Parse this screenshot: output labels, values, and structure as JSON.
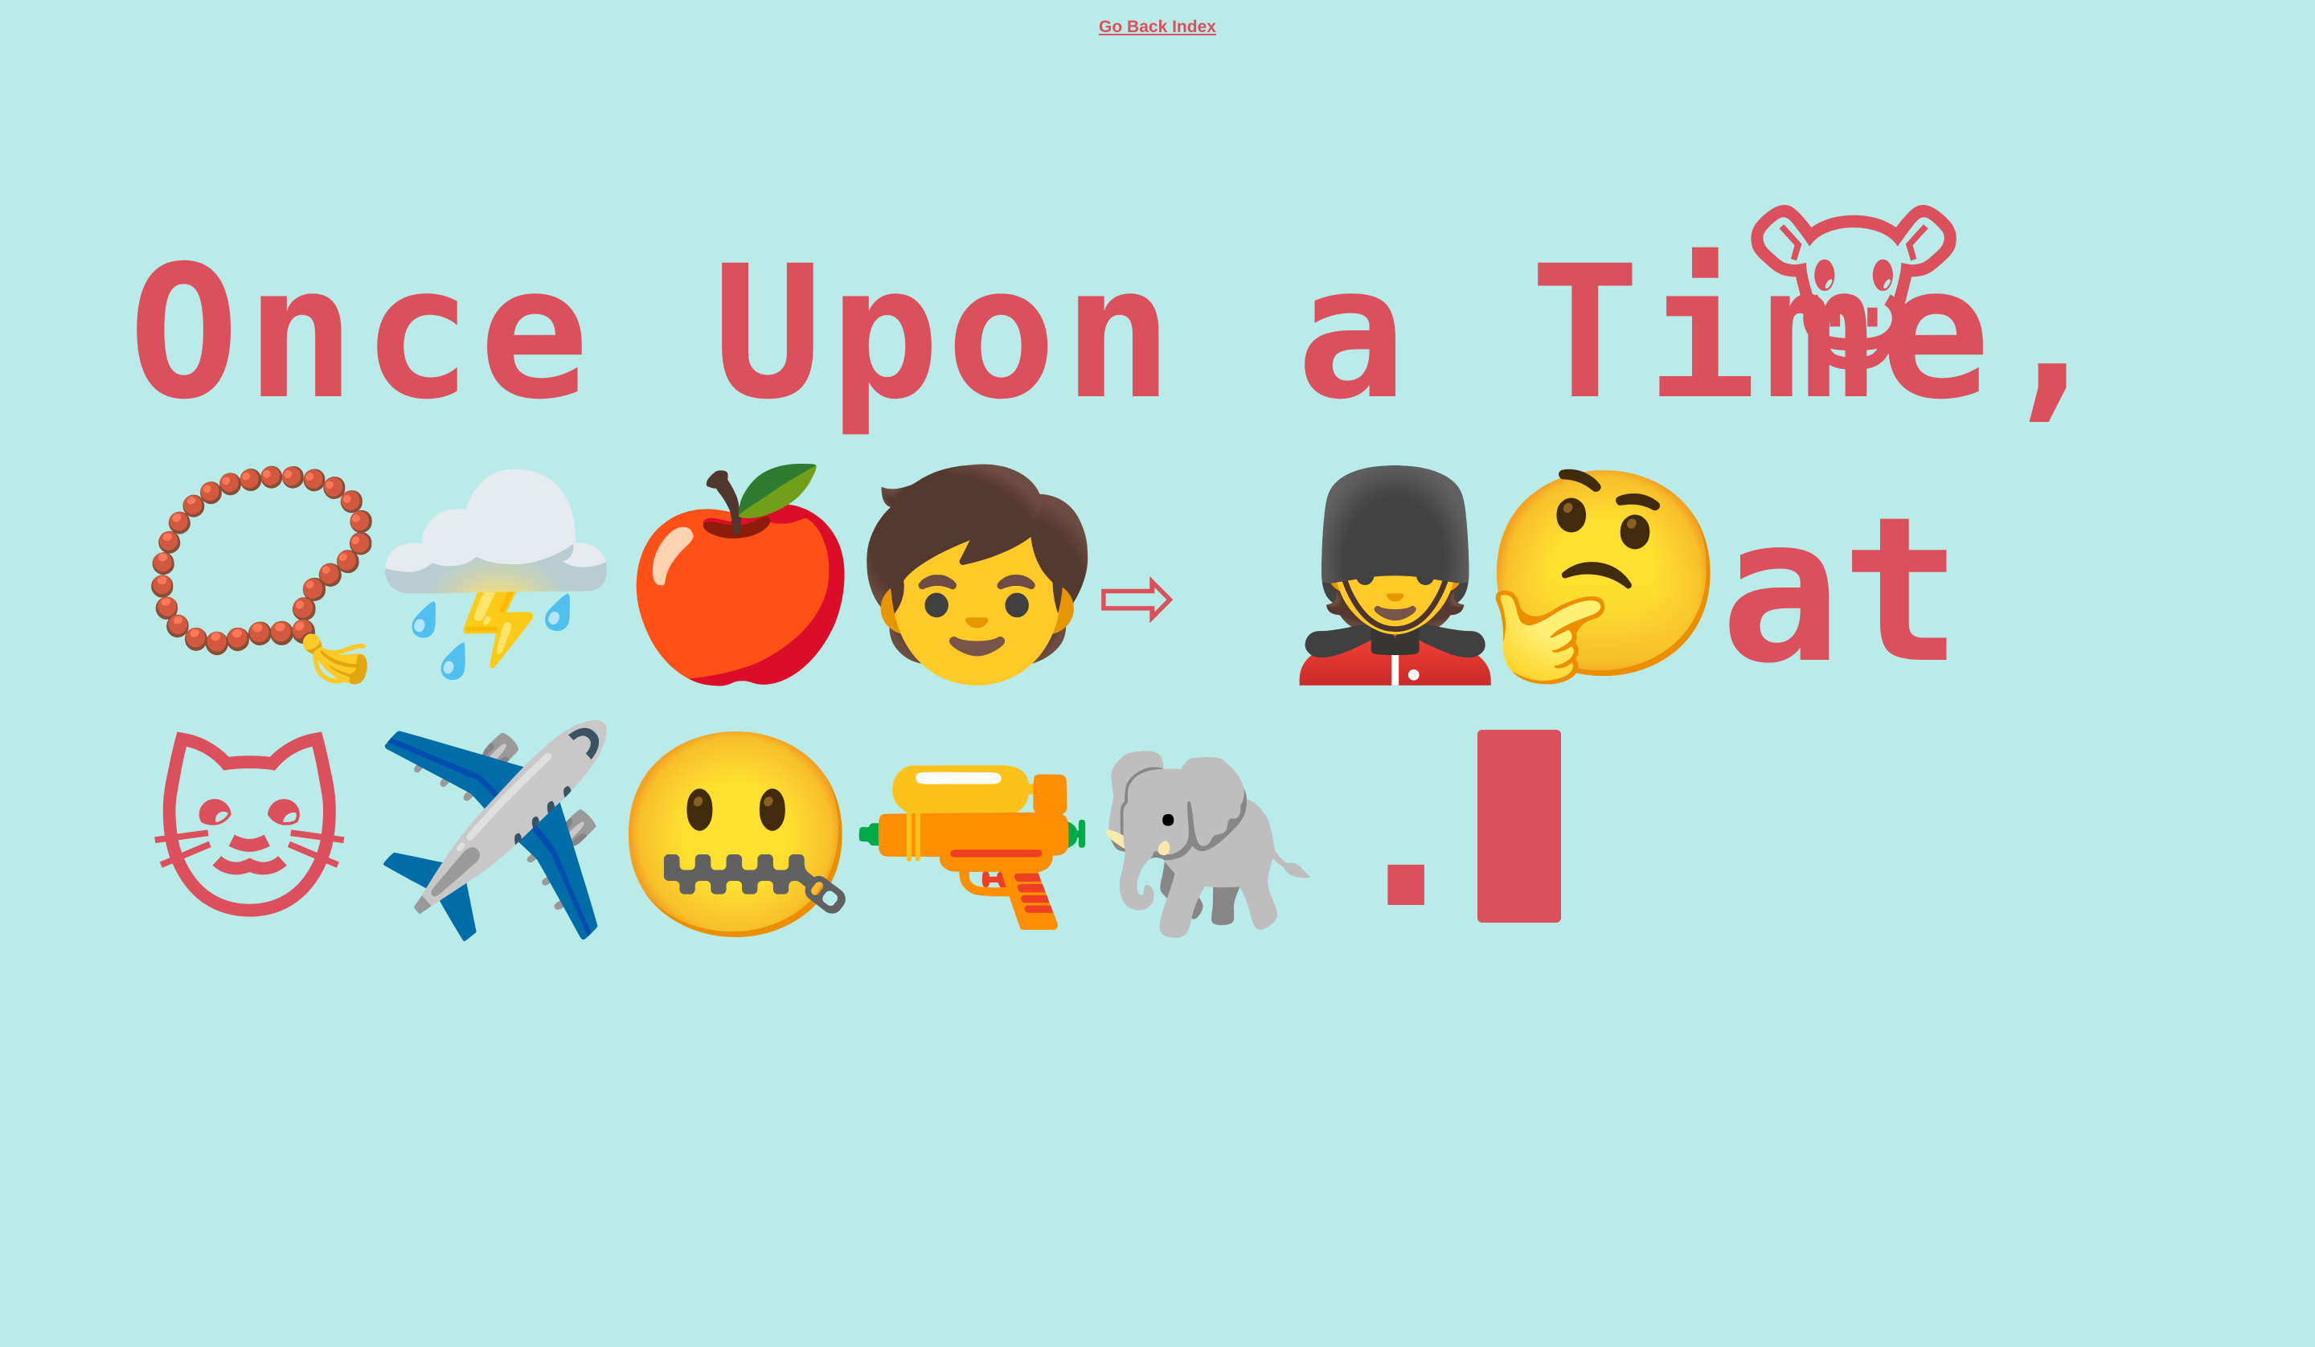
{
  "nav": {
    "back_label": "Go Back Index"
  },
  "story": {
    "line1": {
      "text": "Once Upon a Time,",
      "emoji_cow": "🐮"
    },
    "line2": {
      "emoji_beads": "📿",
      "emoji_storm": "⛈️",
      "emoji_apple": "🍎",
      "emoji_child": "🧒",
      "arrow": "⇨",
      "emoji_guard": "💂",
      "emoji_thinking": "🤔",
      "text_at": "at"
    },
    "line3": {
      "emoji_cat": "🐱",
      "emoji_plane": "✈️",
      "emoji_zipper": "🤐",
      "emoji_pistol": "🔫",
      "emoji_elephant": "🐘",
      "text_period": "."
    }
  },
  "colors": {
    "background": "#b9ece9",
    "text": "#dc505e"
  }
}
